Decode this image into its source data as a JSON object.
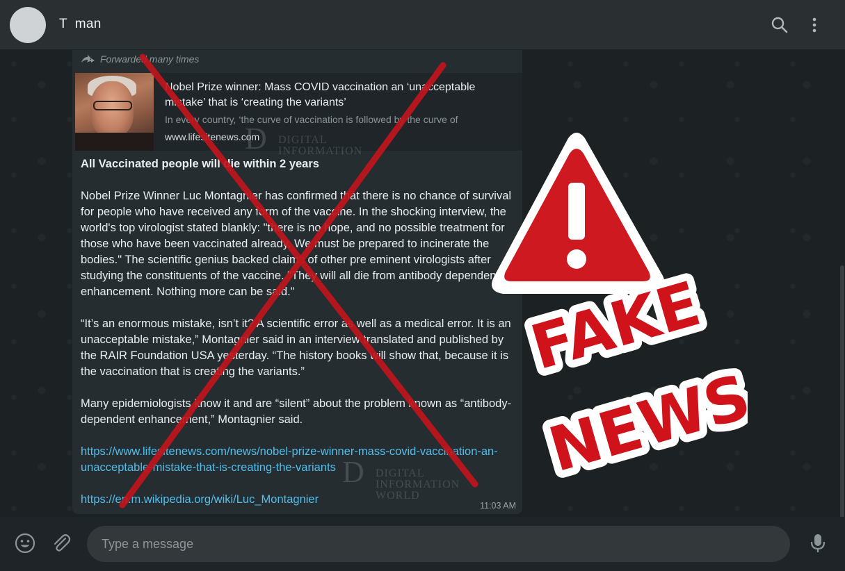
{
  "header": {
    "contact_name": "T  man"
  },
  "message": {
    "forwarded_label": "Forwarded many times",
    "link_preview": {
      "title": "Nobel Prize winner: Mass COVID vaccination an ‘unacceptable mistake’ that is ‘creating the variants’",
      "description": "In every country, ‘the curve of vaccination is followed by the curve of",
      "domain": "www.lifesitenews.com"
    },
    "headline": "All Vaccinated people will die within 2 years",
    "paragraphs": [
      "Nobel Prize Winner Luc Montagnier has confirmed that there is no chance of survival for people who have received any form of the vaccine. In the shocking interview, the world's top virologist stated blankly: \"there is no hope, and no possible treatment for those who have been vaccinated already. We must be prepared to incinerate the bodies.\" The scientific genius backed claims of other pre eminent virologists after studying the constituents of the vaccine. \"They will all die from antibody dependent enhancement. Nothing more can be said.\"",
      "“It’s an enormous mistake, isn’t it? A scientific error as well as a medical error. It is an unacceptable mistake,” Montagnier said in an interview translated and published by the RAIR Foundation USA yesterday. “The history books will show that, because it is the vaccination that is creating the variants.”",
      "Many epidemiologists know it and are “silent” about the problem known as “antibody-dependent enhancement,” Montagnier said."
    ],
    "links": [
      "https://www.lifesitenews.com/news/nobel-prize-winner-mass-covid-vaccination-an-unacceptable-mistake-that-is-creating-the-variants",
      "https://en.m.wikipedia.org/wiki/Luc_Montagnier"
    ],
    "time": "11:03 AM"
  },
  "watermark": {
    "letter": "D",
    "line1": "DIGITAL",
    "line2": "INFORMATION",
    "line3": "WORLD"
  },
  "stamp": {
    "line1": "FAKE",
    "line2": "NEWS",
    "color": "#d0121b"
  },
  "composer": {
    "placeholder": "Type a message"
  },
  "colors": {
    "header_bg": "#2a2f32",
    "bubble_bg": "#262d31",
    "link": "#53bdeb",
    "cross": "#c0151c"
  }
}
